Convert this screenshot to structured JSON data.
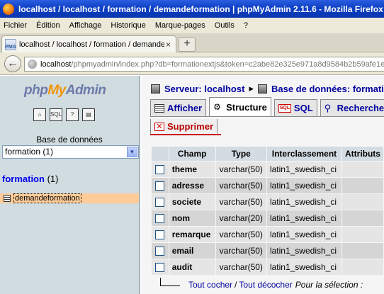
{
  "window": {
    "title": "localhost / localhost / formation / demandeformation | phpMyAdmin 2.11.6 - Mozilla Firefox"
  },
  "menu": [
    "Fichier",
    "Édition",
    "Affichage",
    "Historique",
    "Marque-pages",
    "Outils",
    "?"
  ],
  "tab": {
    "icon": "phpmyadmin-favicon-icon",
    "label": "localhost / localhost / formation / demandeformation",
    "close": "×",
    "new": "+"
  },
  "nav": {
    "back": "←",
    "url_host": "localhost",
    "url_rest": "/phpmyadmin/index.php?db=formationextjs&token=c2abe82e325e971a8d9584b2b59afe1e"
  },
  "left": {
    "logo": {
      "php": "php",
      "my": "My",
      "admin": "Admin"
    },
    "icons": [
      "home-icon",
      "sql-query-icon",
      "help-icon",
      "documentation-icon"
    ],
    "db_label": "Base de données",
    "db_select": "formation (1)",
    "db_name": "formation",
    "db_count": "(1)",
    "tables": [
      "demandeformation"
    ]
  },
  "right": {
    "breadcrumb": {
      "server_label": "Serveur: localhost",
      "separator": "▸",
      "db_label": "Base de données: formation"
    },
    "tabs": [
      {
        "label": "Afficher",
        "icon": "browse-icon"
      },
      {
        "label": "Structure",
        "icon": "structure-icon",
        "active": true
      },
      {
        "label": "SQL",
        "icon": "sql-icon"
      },
      {
        "label": "Rechercher",
        "icon": "search-icon"
      }
    ],
    "drop_label": "Supprimer",
    "table": {
      "headers": [
        "",
        "Champ",
        "Type",
        "Interclassement",
        "Attributs"
      ],
      "rows": [
        {
          "field": "theme",
          "type": "varchar(50)",
          "collation": "latin1_swedish_ci"
        },
        {
          "field": "adresse",
          "type": "varchar(50)",
          "collation": "latin1_swedish_ci"
        },
        {
          "field": "societe",
          "type": "varchar(50)",
          "collation": "latin1_swedish_ci"
        },
        {
          "field": "nom",
          "type": "varchar(20)",
          "collation": "latin1_swedish_ci"
        },
        {
          "field": "remarque",
          "type": "varchar(50)",
          "collation": "latin1_swedish_ci"
        },
        {
          "field": "email",
          "type": "varchar(50)",
          "collation": "latin1_swedish_ci"
        },
        {
          "field": "audit",
          "type": "varchar(50)",
          "collation": "latin1_swedish_ci"
        }
      ]
    },
    "footer": {
      "check_all": "Tout cocher",
      "separator": "/",
      "uncheck_all": "Tout décocher",
      "selection": "Pour la sélection :"
    }
  }
}
